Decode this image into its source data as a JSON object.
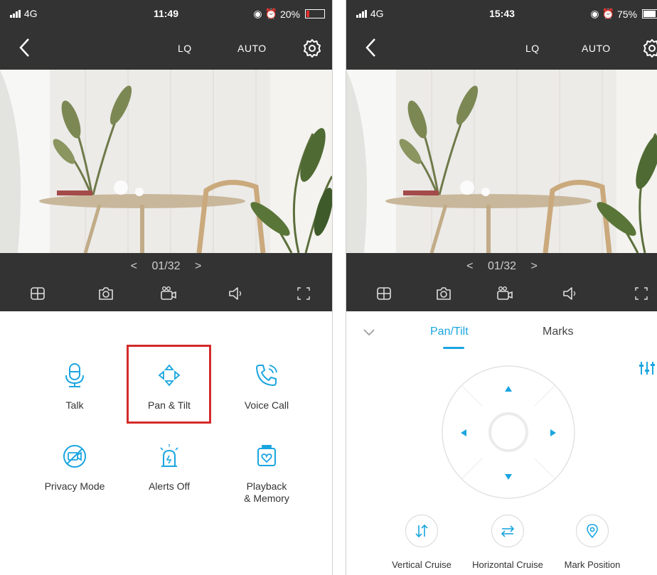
{
  "left_phone": {
    "status": {
      "signal": "4G",
      "time": "11:49",
      "battery": "20%",
      "battery_level": 0.2,
      "battery_color": "#e02c2c"
    },
    "header": {
      "quality": "LQ",
      "mode": "AUTO"
    },
    "pager": {
      "prev": "<",
      "page": "01/32",
      "next": ">"
    },
    "functions": [
      {
        "label": "Talk"
      },
      {
        "label": "Pan & Tilt"
      },
      {
        "label": "Voice Call"
      },
      {
        "label": "Privacy Mode"
      },
      {
        "label": "Alerts Off"
      },
      {
        "label": "Playback\n& Memory"
      }
    ]
  },
  "right_phone": {
    "status": {
      "signal": "4G",
      "time": "15:43",
      "battery": "75%",
      "battery_level": 0.75,
      "battery_color": "#ffffff"
    },
    "header": {
      "quality": "LQ",
      "mode": "AUTO"
    },
    "pager": {
      "prev": "<",
      "page": "01/32",
      "next": ">"
    },
    "tabs": {
      "active": "Pan/Tilt",
      "other": "Marks"
    },
    "cruise_buttons": [
      {
        "label": "Vertical Cruise"
      },
      {
        "label": "Horizontal Cruise"
      },
      {
        "label": "Mark Position"
      }
    ]
  },
  "colors": {
    "accent": "#1aa5e0",
    "dark_bar": "#333333",
    "highlight": "#d42a2a"
  }
}
